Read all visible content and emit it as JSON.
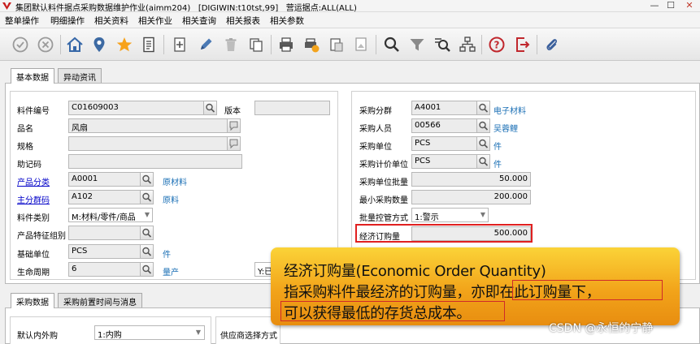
{
  "window": {
    "title": "集团默认料件据点采购数据维护作业(aimm204)   [DIGIWIN:t10tst,99]   营运据点:ALL(ALL)",
    "min_label": "—",
    "max_label": "☐",
    "close_label": "✕"
  },
  "menu": [
    "整单操作",
    "明细操作",
    "相关资料",
    "相关作业",
    "相关查询",
    "相关报表",
    "相关参数"
  ],
  "tabs_top": [
    "基本数据",
    "异动资讯"
  ],
  "tabs_bottom": [
    "采购数据",
    "采购前置时间与消息"
  ],
  "left_form": {
    "item_no": {
      "label": "料件编号",
      "value": "C01609003"
    },
    "version": {
      "label": "版本",
      "value": ""
    },
    "name": {
      "label": "品名",
      "value": "风扇"
    },
    "spec": {
      "label": "规格",
      "value": ""
    },
    "mnemonic": {
      "label": "助记码",
      "value": ""
    },
    "product_class": {
      "label": "产品分类",
      "value": "A0001",
      "desc": "原材料"
    },
    "main_group": {
      "label": "主分群码",
      "value": "A102",
      "desc": "原料"
    },
    "item_type": {
      "label": "料件类别",
      "value": "M:材料/零件/商品"
    },
    "feature_group": {
      "label": "产品特征组别",
      "value": ""
    },
    "base_unit": {
      "label": "基础单位",
      "value": "PCS",
      "desc": "件"
    },
    "life_cycle": {
      "label": "生命周期",
      "value": "6",
      "desc": "量产"
    },
    "partial_field": {
      "value": "Y:已"
    }
  },
  "right_form": {
    "purchase_group": {
      "label": "采购分群",
      "value": "A4001",
      "desc": "电子材料"
    },
    "buyer": {
      "label": "采购人员",
      "value": "00566",
      "desc": "吴蓉鲤"
    },
    "purchase_unit": {
      "label": "采购单位",
      "value": "PCS",
      "desc": "件"
    },
    "pricing_unit": {
      "label": "采购计价单位",
      "value": "PCS",
      "desc": "件"
    },
    "unit_batch": {
      "label": "采购单位批量",
      "value": "50.000"
    },
    "min_qty": {
      "label": "最小采购数量",
      "value": "200.000"
    },
    "batch_control": {
      "label": "批量控管方式",
      "value": "1:警示"
    },
    "eoq": {
      "label": "经济订购量",
      "value": "500.000"
    }
  },
  "bottom_form": {
    "default_inout": {
      "label": "默认内外购",
      "value": "1:内购"
    },
    "supplier_label": "供应商选择方式"
  },
  "callout": {
    "line1": "经济订购量(Economic Order Quantity)",
    "line2": "指采购料件最经济的订购量，亦即在此订购量下，",
    "line3": "可以获得最低的存货总成本。"
  },
  "watermark": "CSDN @永恒的宁静",
  "colors": {
    "accent_link": "#0000c8",
    "desc_text": "#1a6fb5",
    "highlight": "#e02020",
    "callout": "#f2a41a"
  }
}
